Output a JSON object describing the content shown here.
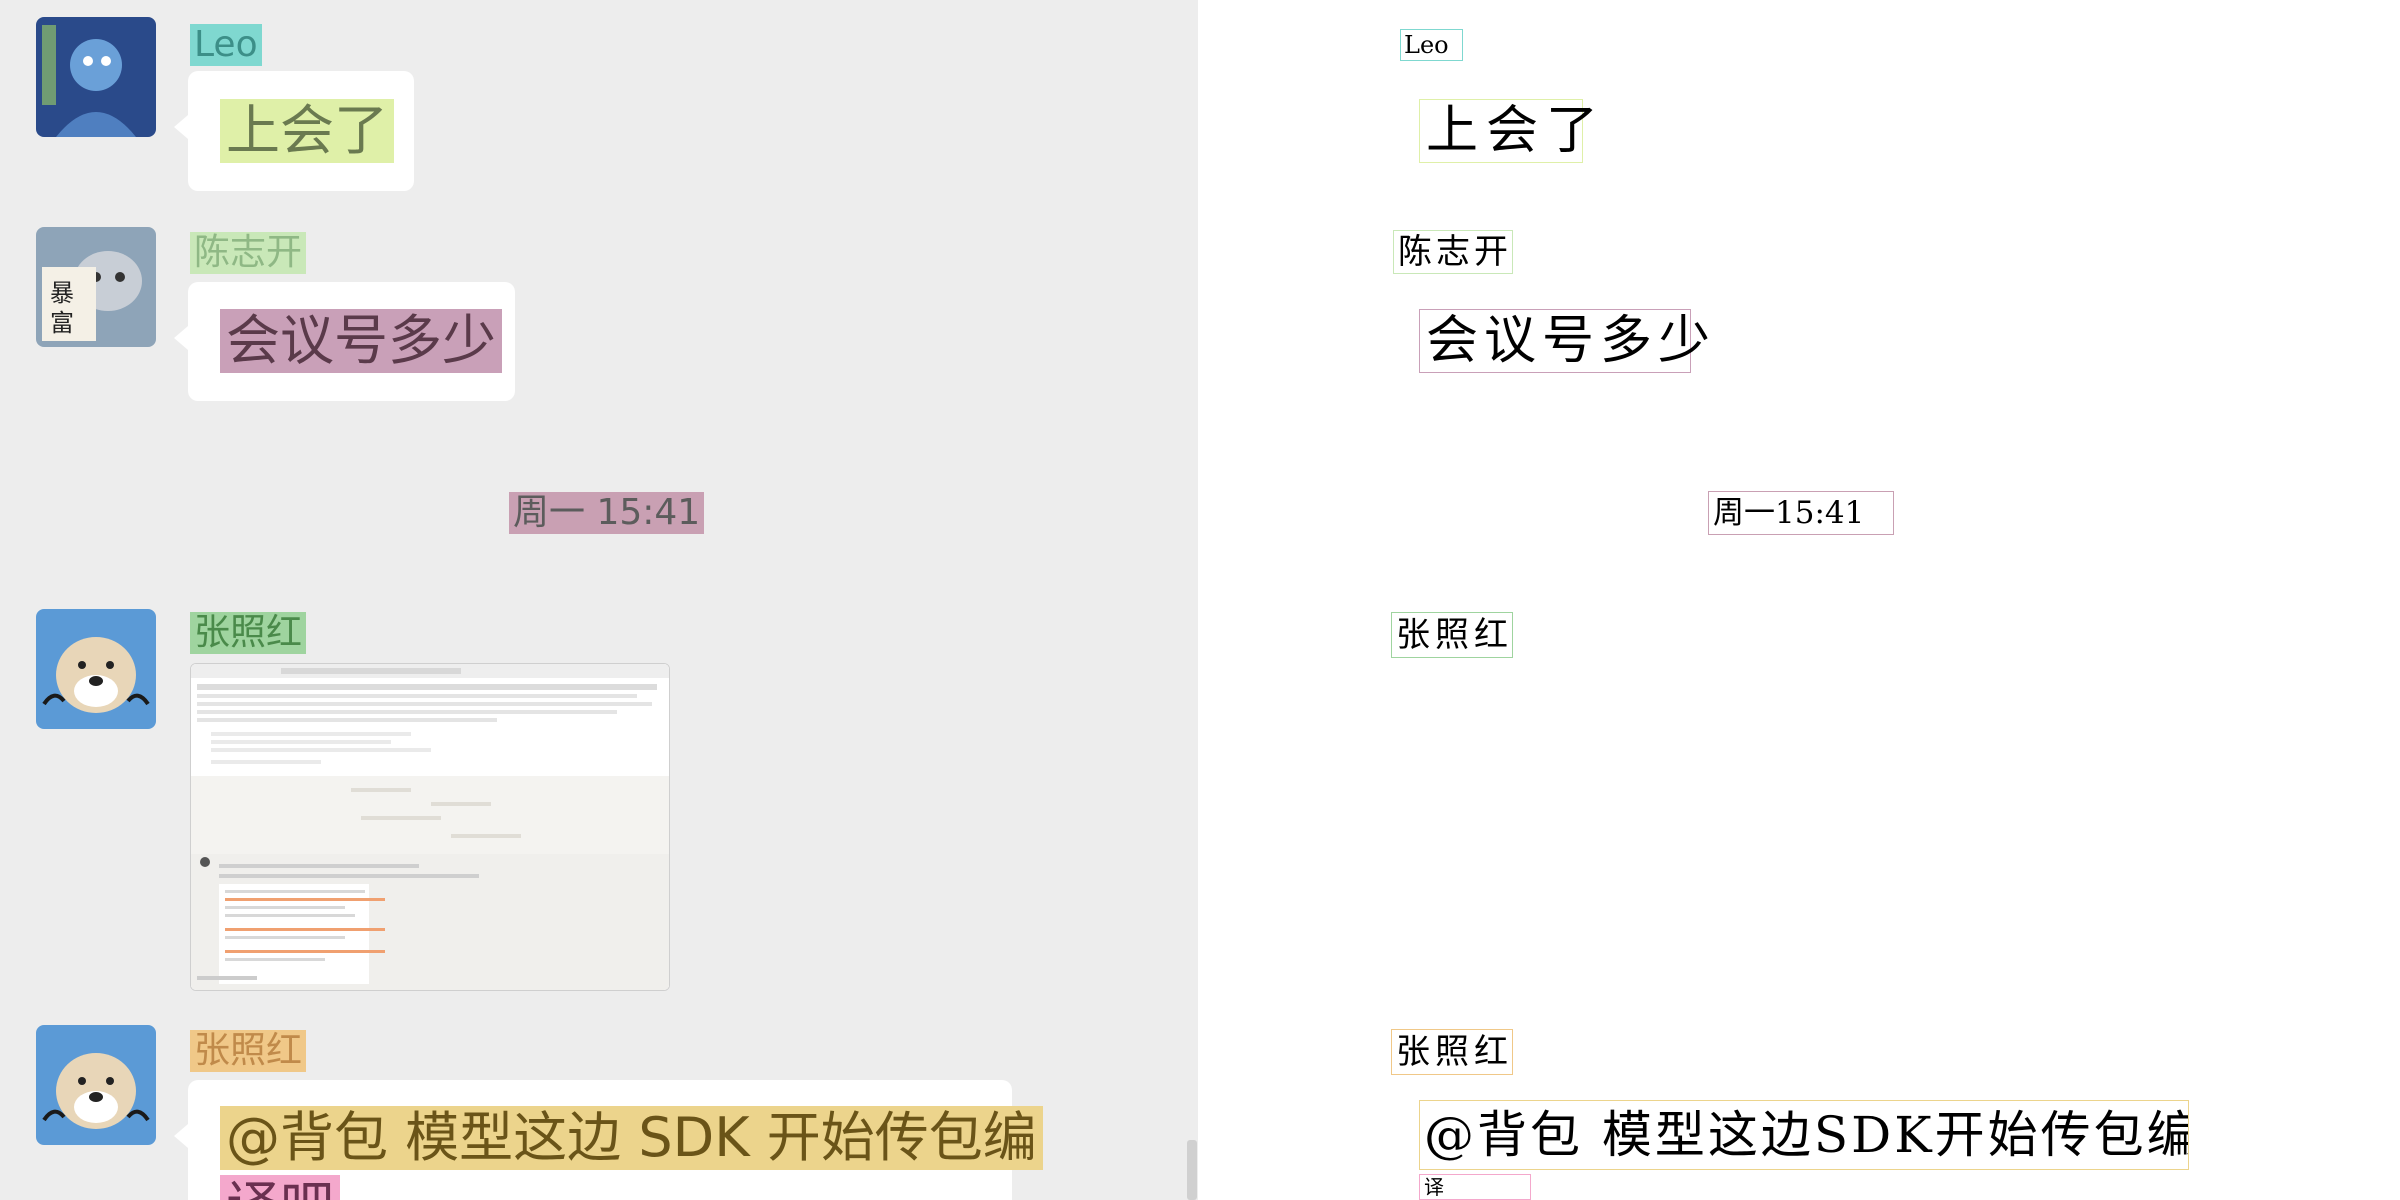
{
  "messages": [
    {
      "sender": "Leo",
      "text": "上会了"
    },
    {
      "sender": "陈志开",
      "text": "会议号多少"
    },
    {
      "sender": "张照红",
      "image_caption": ""
    },
    {
      "sender": "张照红",
      "text_line1": "@背包  模型这边 SDK 开始传包编",
      "text_line2": "译吧"
    }
  ],
  "timestamp": "周一 15:41",
  "annotations": {
    "leo": "Leo",
    "msg1": "上会了",
    "sender2": "陈志开",
    "msg2": "会议号多少",
    "timestamp": "周一15:41",
    "sender3": "张照红",
    "sender4": "张照红",
    "msg4_line1": "@背包 模型这边SDK开始传包编",
    "msg4_line2": "译"
  },
  "colors": {
    "chat_bg": "#ededed",
    "bubble_bg": "#ffffff",
    "highlight_leo": "#7fd8d0",
    "highlight_msg1": "#dff0a8",
    "highlight_sender2": "#c9e8b8",
    "highlight_msg2": "#c9a0b8",
    "highlight_timestamp": "#c9a0b3",
    "highlight_sender3": "#9fd49f",
    "highlight_sender4": "#f0c888",
    "highlight_msg4": "#ecd48c",
    "highlight_msg4b": "#f4a8cc"
  }
}
